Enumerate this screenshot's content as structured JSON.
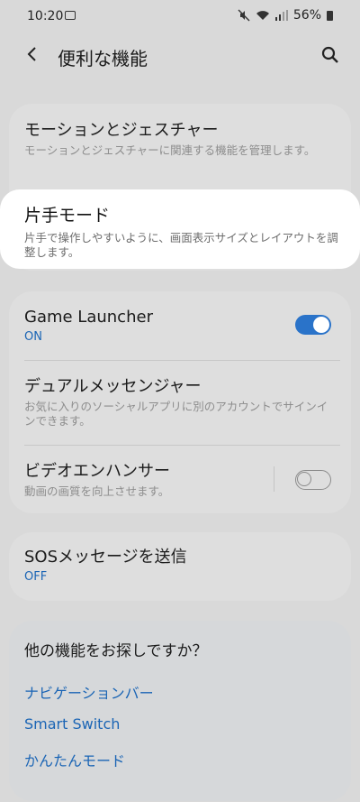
{
  "status": {
    "time": "10:20",
    "battery": "56%"
  },
  "header": {
    "title": "便利な機能"
  },
  "items": {
    "motion": {
      "title": "モーションとジェスチャー",
      "desc": "モーションとジェスチャーに関連する機能を管理します。"
    },
    "onehand": {
      "title": "片手モード",
      "desc": "片手で操作しやすいように、画面表示サイズとレイアウトを調整します。"
    },
    "game": {
      "title": "Game Launcher",
      "status": "ON"
    },
    "dual": {
      "title": "デュアルメッセンジャー",
      "desc": "お気に入りのソーシャルアプリに別のアカウントでサインインできます。"
    },
    "video": {
      "title": "ビデオエンハンサー",
      "desc": "動画の画質を向上させます。"
    },
    "sos": {
      "title": "SOSメッセージを送信",
      "status": "OFF"
    }
  },
  "suggest": {
    "heading": "他の機能をお探しですか？",
    "links": [
      "ナビゲーションバー",
      "Smart Switch",
      "かんたんモード"
    ]
  }
}
